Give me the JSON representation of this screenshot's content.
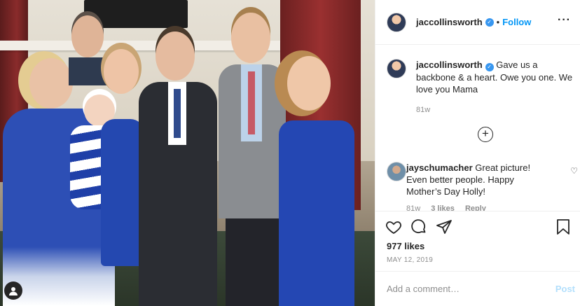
{
  "post": {
    "username": "jaccollinsworth",
    "follow_label": "Follow",
    "separator": "•",
    "more_label": "···",
    "caption": "Gave us a backbone & a heart. Owe you one. We love you Mama",
    "caption_age": "81w",
    "add_label": "+",
    "likes": "977 likes",
    "date": "MAY 12, 2019"
  },
  "comments": [
    {
      "username": "jayschumacher",
      "text": "Great picture! Even better people. Happy Mother’s Day Holly!",
      "age": "81w",
      "likes": "3 likes",
      "reply_label": "Reply"
    }
  ],
  "composer": {
    "placeholder": "Add a comment…",
    "post_label": "Post"
  },
  "colors": {
    "accent": "#0095f6",
    "verified": "#3897f0",
    "muted": "#8e8e8e",
    "post_disabled": "#b2dffc"
  },
  "icons": [
    "verified-icon",
    "more-icon",
    "add-icon",
    "heart-icon",
    "comment-icon",
    "share-icon",
    "bookmark-icon",
    "user-icon"
  ]
}
